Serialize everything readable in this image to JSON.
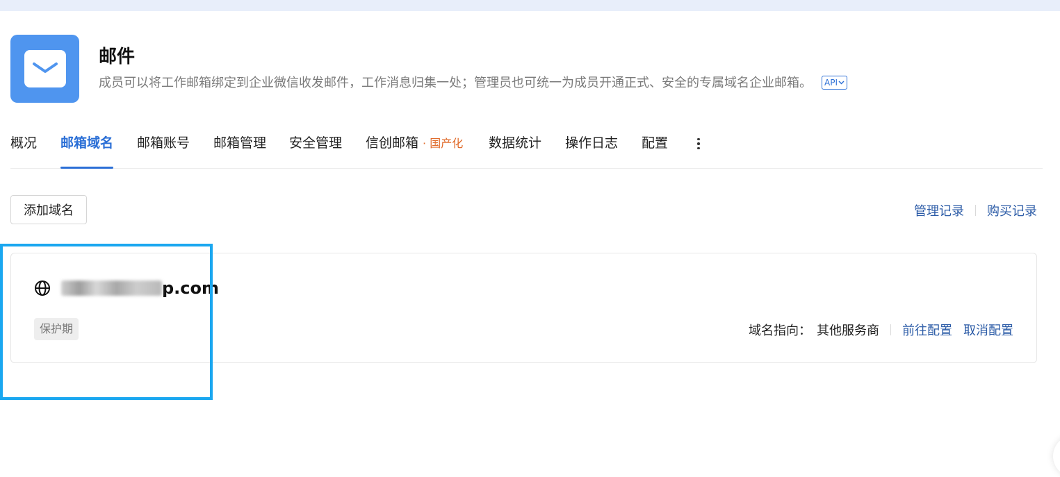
{
  "app": {
    "title": "邮件",
    "description": "成员可以将工作邮箱绑定到企业微信收发邮件，工作消息归集一处；管理员也可统一为成员开通正式、安全的专属域名企业邮箱。",
    "api_label": "API",
    "icon": "envelope-icon",
    "accent_color": "#4f95ef"
  },
  "tabs": [
    {
      "label": "概况",
      "active": false
    },
    {
      "label": "邮箱域名",
      "active": true
    },
    {
      "label": "邮箱账号",
      "active": false
    },
    {
      "label": "邮箱管理",
      "active": false
    },
    {
      "label": "安全管理",
      "active": false
    },
    {
      "label": "信创邮箱",
      "tag": "· 国产化",
      "active": false
    },
    {
      "label": "数据统计",
      "active": false
    },
    {
      "label": "操作日志",
      "active": false
    },
    {
      "label": "配置",
      "active": false
    }
  ],
  "toolbar": {
    "add_domain_label": "添加域名",
    "manage_records_label": "管理记录",
    "purchase_records_label": "购买记录"
  },
  "domain_card": {
    "domain_suffix": "p.com",
    "status_badge": "保护期",
    "pointing_label": "域名指向：",
    "pointing_value": "其他服务商",
    "goto_config_label": "前往配置",
    "cancel_config_label": "取消配置"
  },
  "colors": {
    "primary": "#2b6fd6",
    "link": "#2a5aa6",
    "tag_orange": "#e06b2b",
    "highlight": "#1aa7f0"
  }
}
